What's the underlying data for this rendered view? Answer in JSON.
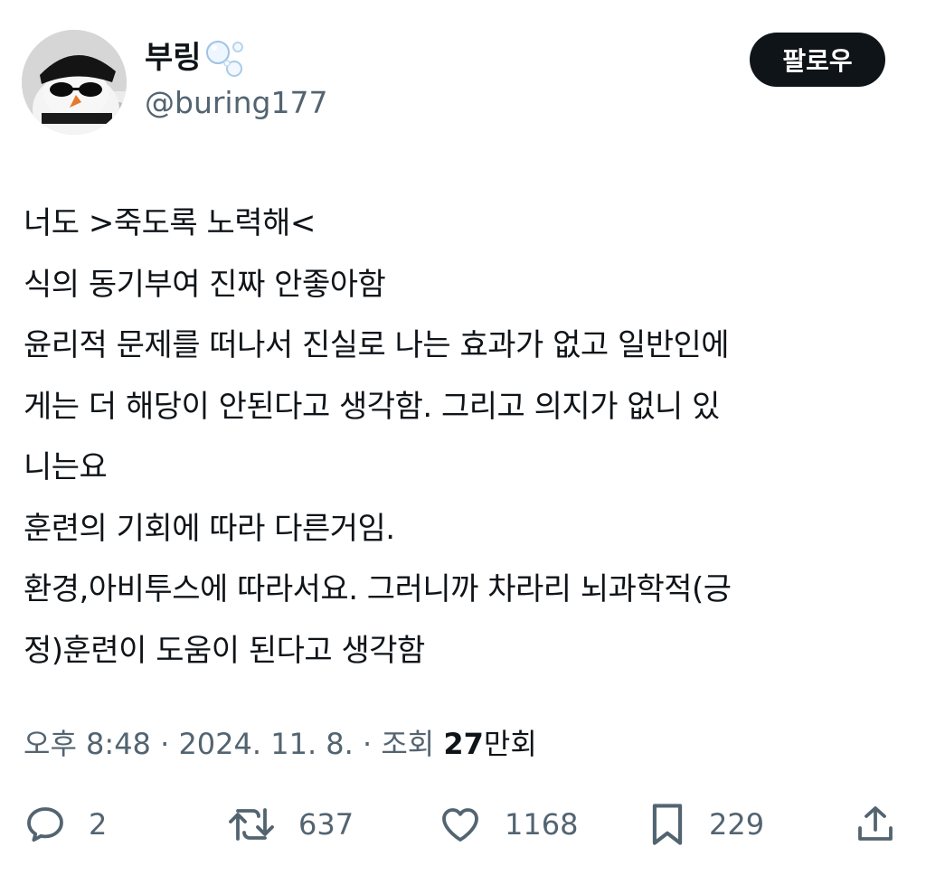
{
  "user": {
    "display_name": "부링",
    "handle": "@buring177"
  },
  "follow_label": "팔로우",
  "tweet": {
    "lines": [
      "너도 >죽도록 노력해<",
      "식의 동기부여 진짜 안좋아함",
      "윤리적 문제를 떠나서 진실로 나는 효과가 없고 일반인에",
      "게는 더 해당이 안된다고 생각함. 그리고 의지가 없니 있",
      "니는요",
      "훈련의 기회에 따라 다른거임.",
      "환경,아비투스에 따라서요. 그러니까 차라리 뇌과학적(긍",
      "정)훈련이 도움이 된다고 생각함"
    ]
  },
  "meta": {
    "time": "오후 8:48",
    "sep1": " · ",
    "date": "2024. 11. 8.",
    "sep2": " · ",
    "views_label": "조회 ",
    "views_count": "27",
    "views_unit": "만회"
  },
  "actions": {
    "replies": "2",
    "retweets": "637",
    "likes": "1168",
    "bookmarks": "229"
  },
  "icons": {
    "reply": "reply-icon",
    "retweet": "retweet-icon",
    "like": "heart-icon",
    "bookmark": "bookmark-icon",
    "share": "share-icon",
    "name_emoji": "bubbles-icon"
  },
  "colors": {
    "text": "#0f1419",
    "secondary": "#536471",
    "button_bg": "#0f1419",
    "button_text": "#ffffff"
  }
}
